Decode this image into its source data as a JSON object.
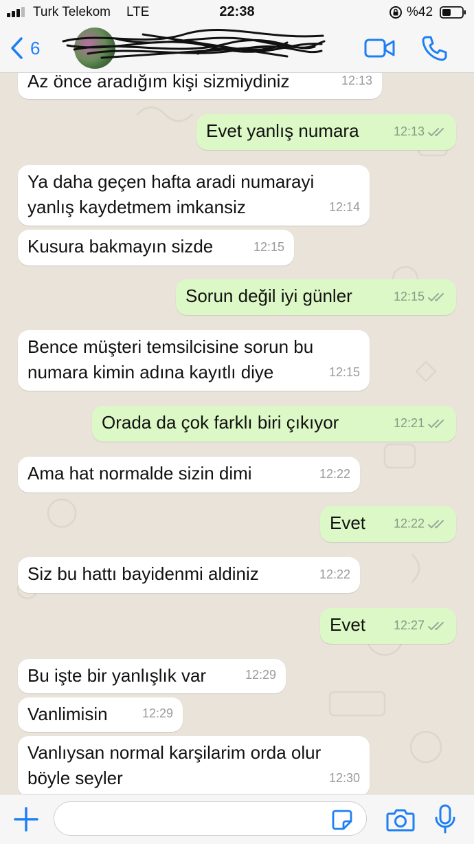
{
  "status_bar": {
    "carrier": "Turk Telekom",
    "network": "LTE",
    "time": "22:38",
    "battery": "%42"
  },
  "nav": {
    "back_count": "6",
    "accent_color": "#1d7ff5"
  },
  "messages": [
    {
      "dir": "in",
      "lines": [
        "Az önce aradığım kişi sizmiydiniz"
      ],
      "time": "12:13"
    },
    {
      "dir": "out",
      "lines": [
        "Evet yanlış numara"
      ],
      "time": "12:13"
    },
    {
      "dir": "in",
      "lines": [
        "Ya daha geçen hafta aradi numarayi",
        "yanlış kaydetmem imkansiz"
      ],
      "time": "12:14"
    },
    {
      "dir": "in",
      "lines": [
        "Kusura bakmayın sizde"
      ],
      "time": "12:15"
    },
    {
      "dir": "out",
      "lines": [
        "Sorun değil iyi günler"
      ],
      "time": "12:15"
    },
    {
      "dir": "in",
      "lines": [
        "Bence müşteri temsilcisine sorun bu",
        "numara kimin adına kayıtlı diye"
      ],
      "time": "12:15"
    },
    {
      "dir": "out",
      "lines": [
        "Orada da çok farklı biri çıkıyor"
      ],
      "time": "12:21"
    },
    {
      "dir": "in",
      "lines": [
        "Ama hat normalde sizin dimi"
      ],
      "time": "12:22"
    },
    {
      "dir": "out",
      "lines": [
        "Evet"
      ],
      "time": "12:22"
    },
    {
      "dir": "in",
      "lines": [
        "Siz bu hattı bayidenmi aldiniz"
      ],
      "time": "12:22"
    },
    {
      "dir": "out",
      "lines": [
        "Evet"
      ],
      "time": "12:27"
    },
    {
      "dir": "in",
      "lines": [
        "Bu işte bir yanlışlık var"
      ],
      "time": "12:29"
    },
    {
      "dir": "in",
      "lines": [
        "Vanlimisin"
      ],
      "time": "12:29"
    },
    {
      "dir": "in",
      "lines": [
        "Vanlıysan normal karşilarim orda olur",
        "böyle seyler"
      ],
      "time": "12:30"
    }
  ],
  "colors": {
    "incoming_bubble": "#ffffff",
    "outgoing_bubble": "#dcf8c6",
    "chat_background": "#e9e3da"
  },
  "icons": [
    "signal-icon",
    "lock-rotation-icon",
    "battery-icon",
    "back-chevron-icon",
    "video-call-icon",
    "phone-icon",
    "plus-icon",
    "sticker-icon",
    "camera-icon",
    "microphone-icon",
    "double-check-icon"
  ]
}
